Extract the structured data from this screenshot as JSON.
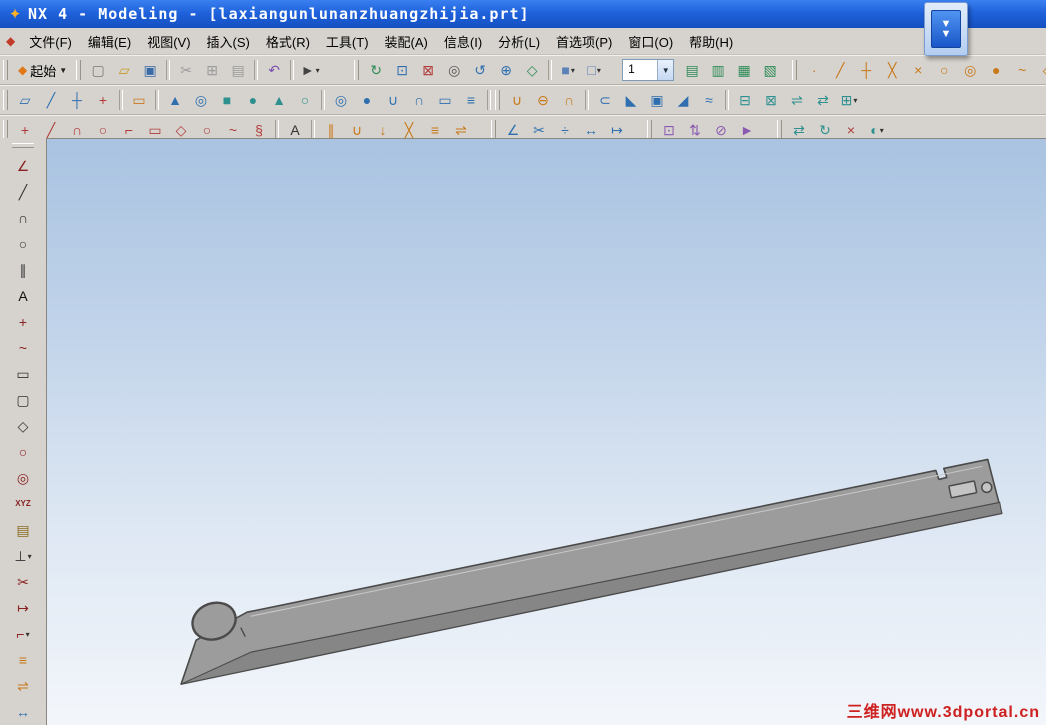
{
  "window": {
    "title": "NX 4 - Modeling - [laxiangunlunanzhuangzhijia.prt]",
    "logo_glyph": "✦"
  },
  "dock_button": {
    "chevron_glyph": "▼"
  },
  "menu_bar": {
    "app_icon_glyph": "◆",
    "items": [
      {
        "name": "menu-file",
        "label": "文件(F)"
      },
      {
        "name": "menu-edit",
        "label": "编辑(E)"
      },
      {
        "name": "menu-view",
        "label": "视图(V)"
      },
      {
        "name": "menu-insert",
        "label": "插入(S)"
      },
      {
        "name": "menu-format",
        "label": "格式(R)"
      },
      {
        "name": "menu-tools",
        "label": "工具(T)"
      },
      {
        "name": "menu-assemblies",
        "label": "装配(A)"
      },
      {
        "name": "menu-information",
        "label": "信息(I)"
      },
      {
        "name": "menu-analysis",
        "label": "分析(L)"
      },
      {
        "name": "menu-preferences",
        "label": "首选项(P)"
      },
      {
        "name": "menu-window",
        "label": "窗口(O)"
      },
      {
        "name": "menu-help",
        "label": "帮助(H)"
      }
    ]
  },
  "toolbars": {
    "standard": {
      "start_label": "起始",
      "start_icon_glyph": "◆",
      "row1a": [
        {
          "grip": true
        },
        {
          "name": "new-file-icon",
          "glyph": "▢",
          "color": "#787878"
        },
        {
          "name": "open-icon",
          "glyph": "▱",
          "color": "#c89a20"
        },
        {
          "name": "save-icon",
          "glyph": "▣",
          "color": "#3a6aa8"
        },
        {
          "sep": true
        },
        {
          "name": "cut-icon",
          "glyph": "✂",
          "color": "#9a9a9a"
        },
        {
          "name": "copy-icon",
          "glyph": "⊞",
          "color": "#9a9a9a"
        },
        {
          "name": "paste-icon",
          "glyph": "▤",
          "color": "#9a9a9a"
        },
        {
          "sep": true
        },
        {
          "name": "undo-icon",
          "glyph": "↶",
          "color": "#7a50b0"
        },
        {
          "sep": true
        },
        {
          "name": "selection-filter-icon",
          "glyph": "►",
          "color": "#444444",
          "dropdown": true
        },
        {
          "sp": 30
        }
      ],
      "row1b": [
        {
          "grip": true
        },
        {
          "name": "refresh-view-icon",
          "glyph": "↻",
          "color": "#2e8b57"
        },
        {
          "name": "fit-view-icon",
          "glyph": "⊡",
          "color": "#2f6fb0"
        },
        {
          "name": "zoom-box-icon",
          "glyph": "⊠",
          "color": "#b03a3a"
        },
        {
          "name": "zoom-in-out-icon",
          "glyph": "◎",
          "color": "#555555"
        },
        {
          "name": "rotate-view-icon",
          "glyph": "↺",
          "color": "#2f6fb0"
        },
        {
          "name": "pan-view-icon",
          "glyph": "⊕",
          "color": "#2f6fb0"
        },
        {
          "name": "perspective-icon",
          "glyph": "◇",
          "color": "#2e8b57"
        },
        {
          "sep": true
        },
        {
          "name": "shaded-view-icon",
          "glyph": "■",
          "color": "#5b82b8",
          "dropdown": true
        },
        {
          "name": "wireframe-view-icon",
          "glyph": "□",
          "color": "#5b82b8",
          "dropdown": true
        },
        {
          "sp": 10
        }
      ],
      "row1c": [
        {
          "name": "layer-settings-icon",
          "glyph": "▤",
          "color": "#2e8b57"
        },
        {
          "name": "visible-layers-icon",
          "glyph": "▥",
          "color": "#2e8b57"
        },
        {
          "name": "layer-category-icon",
          "glyph": "▦",
          "color": "#2e8b57"
        },
        {
          "name": "work-layer-icon",
          "glyph": "▧",
          "color": "#2e8b57"
        },
        {
          "sp": 8
        }
      ],
      "row1d": [
        {
          "grip": true
        },
        {
          "name": "snap-point-icon",
          "glyph": "·",
          "color": "#c87818"
        },
        {
          "name": "snap-endpoint-icon",
          "glyph": "╱",
          "color": "#c87818"
        },
        {
          "name": "snap-midpoint-icon",
          "glyph": "┼",
          "color": "#c87818"
        },
        {
          "name": "snap-control-point-icon",
          "glyph": "╳",
          "color": "#c87818"
        },
        {
          "name": "snap-intersection-icon",
          "glyph": "×",
          "color": "#c87818"
        },
        {
          "name": "snap-arc-center-icon",
          "glyph": "○",
          "color": "#c87818"
        },
        {
          "name": "snap-quadrant-icon",
          "glyph": "◎",
          "color": "#c87818"
        },
        {
          "name": "snap-existing-point-icon",
          "glyph": "●",
          "color": "#c87818"
        },
        {
          "name": "snap-point-on-curve-icon",
          "glyph": "~",
          "color": "#c87818"
        },
        {
          "name": "snap-point-on-surface-icon",
          "glyph": "◇",
          "color": "#c87818"
        }
      ]
    },
    "layer_combo": {
      "value": "1"
    },
    "row2": [
      {
        "grip": true
      },
      {
        "name": "datum-plane-icon",
        "glyph": "▱",
        "color": "#2f6fb0"
      },
      {
        "name": "datum-axis-icon",
        "glyph": "╱",
        "color": "#2f6fb0"
      },
      {
        "name": "datum-csys-icon",
        "glyph": "┼",
        "color": "#2f6fb0"
      },
      {
        "name": "point-tool-icon",
        "glyph": "+",
        "color": "#b03a3a"
      },
      {
        "sep": true
      },
      {
        "name": "sketch-icon",
        "glyph": "▭",
        "color": "#c87818"
      },
      {
        "sep": true
      },
      {
        "name": "extrude-icon",
        "glyph": "▲",
        "color": "#2f6fb0"
      },
      {
        "name": "revolve-icon",
        "glyph": "◎",
        "color": "#2f6fb0"
      },
      {
        "name": "block-icon",
        "glyph": "■",
        "color": "#2f9090"
      },
      {
        "name": "cylinder-icon",
        "glyph": "●",
        "color": "#2f9090"
      },
      {
        "name": "cone-icon",
        "glyph": "▲",
        "color": "#2f9090"
      },
      {
        "name": "sphere-icon",
        "glyph": "○",
        "color": "#2f9090"
      },
      {
        "sep": true
      },
      {
        "name": "hole-icon",
        "glyph": "◎",
        "color": "#2f6fb0"
      },
      {
        "name": "boss-icon",
        "glyph": "●",
        "color": "#2f6fb0"
      },
      {
        "name": "pocket-icon",
        "glyph": "∪",
        "color": "#2f6fb0"
      },
      {
        "name": "pad-icon",
        "glyph": "∩",
        "color": "#2f6fb0"
      },
      {
        "name": "slot-icon",
        "glyph": "▭",
        "color": "#2f6fb0"
      },
      {
        "name": "groove-icon",
        "glyph": "≡",
        "color": "#2f6fb0"
      },
      {
        "sep": true
      },
      {
        "grip": true
      },
      {
        "name": "unite-icon",
        "glyph": "∪",
        "color": "#c87818"
      },
      {
        "name": "subtract-icon",
        "glyph": "⊖",
        "color": "#c87818"
      },
      {
        "name": "intersect-icon",
        "glyph": "∩",
        "color": "#c87818"
      },
      {
        "sep": true
      },
      {
        "name": "edge-blend-icon",
        "glyph": "⊂",
        "color": "#2f6fb0"
      },
      {
        "name": "chamfer-icon",
        "glyph": "◣",
        "color": "#2f6fb0"
      },
      {
        "name": "shell-icon",
        "glyph": "▣",
        "color": "#2f6fb0"
      },
      {
        "name": "taper-icon",
        "glyph": "◢",
        "color": "#2f6fb0"
      },
      {
        "name": "thread-icon",
        "glyph": "≈",
        "color": "#2f6fb0"
      },
      {
        "sep": true
      },
      {
        "name": "trim-body-icon",
        "glyph": "⊟",
        "color": "#2f9090"
      },
      {
        "name": "split-body-icon",
        "glyph": "⊠",
        "color": "#2f9090"
      },
      {
        "name": "sew-icon",
        "glyph": "⇌",
        "color": "#2f9090"
      },
      {
        "name": "mirror-body-icon",
        "glyph": "⇄",
        "color": "#2f9090"
      },
      {
        "name": "instance-feature-icon",
        "glyph": "⊞",
        "color": "#2f9090",
        "dropdown": true
      }
    ],
    "row3": [
      {
        "grip": true
      },
      {
        "name": "curve-point-icon",
        "glyph": "+",
        "color": "#b03a3a"
      },
      {
        "name": "line-icon",
        "glyph": "╱",
        "color": "#b03a3a"
      },
      {
        "name": "arc-icon",
        "glyph": "∩",
        "color": "#b03a3a"
      },
      {
        "name": "circle-icon",
        "glyph": "○",
        "color": "#b03a3a"
      },
      {
        "name": "fillet-curve-icon",
        "glyph": "⌐",
        "color": "#b03a3a"
      },
      {
        "name": "rectangle-icon",
        "glyph": "▭",
        "color": "#b03a3a"
      },
      {
        "name": "polygon-icon",
        "glyph": "◇",
        "color": "#b03a3a"
      },
      {
        "name": "ellipse-icon",
        "glyph": "○",
        "color": "#b03a3a"
      },
      {
        "name": "spline-icon",
        "glyph": "~",
        "color": "#b03a3a"
      },
      {
        "name": "helix-icon",
        "glyph": "§",
        "color": "#b03a3a"
      },
      {
        "sep": true
      },
      {
        "name": "text-curve-icon",
        "glyph": "A",
        "color": "#333333"
      },
      {
        "sep": true
      },
      {
        "name": "offset-curve-icon",
        "glyph": "∥",
        "color": "#c87818"
      },
      {
        "name": "bridge-curve-icon",
        "glyph": "∪",
        "color": "#c87818"
      },
      {
        "name": "project-curve-icon",
        "glyph": "↓",
        "color": "#c87818"
      },
      {
        "name": "intersection-curve-icon",
        "glyph": "╳",
        "color": "#c87818"
      },
      {
        "name": "section-curve-icon",
        "glyph": "≡",
        "color": "#c87818"
      },
      {
        "name": "join-curve-icon",
        "glyph": "⇌",
        "color": "#c87818"
      },
      {
        "sp": 16
      },
      {
        "grip": true
      },
      {
        "name": "edit-curve-parameters-icon",
        "glyph": "∠",
        "color": "#2f6fb0"
      },
      {
        "name": "trim-curve-icon",
        "glyph": "✂",
        "color": "#2f6fb0"
      },
      {
        "name": "divide-curve-icon",
        "glyph": "÷",
        "color": "#2f6fb0"
      },
      {
        "name": "stretch-curve-icon",
        "glyph": "↔",
        "color": "#2f6fb0"
      },
      {
        "name": "curve-length-icon",
        "glyph": "↦",
        "color": "#2f6fb0"
      },
      {
        "sp": 16
      },
      {
        "grip": true
      },
      {
        "name": "edit-feature-icon",
        "glyph": "⊡",
        "color": "#8a5ab0"
      },
      {
        "name": "reorder-feature-icon",
        "glyph": "⇅",
        "color": "#8a5ab0"
      },
      {
        "name": "suppress-feature-icon",
        "glyph": "⊘",
        "color": "#8a5ab0"
      },
      {
        "name": "playback-icon",
        "glyph": "►",
        "color": "#8a5ab0"
      },
      {
        "sp": 16
      },
      {
        "grip": true
      },
      {
        "name": "move-object-icon",
        "glyph": "⇄",
        "color": "#2f9090"
      },
      {
        "name": "transform-icon",
        "glyph": "↻",
        "color": "#2f9090"
      },
      {
        "name": "delete-icon",
        "glyph": "×",
        "color": "#b03a3a"
      },
      {
        "name": "show-hide-icon",
        "glyph": "◐",
        "color": "#2f9090",
        "dropdown": true
      }
    ],
    "left": [
      {
        "name": "profile-icon",
        "glyph": "∠",
        "color": "#8a2020"
      },
      {
        "name": "line-sketch-icon",
        "glyph": "╱",
        "color": "#333333"
      },
      {
        "name": "arc-sketch-icon",
        "glyph": "∩",
        "color": "#333333"
      },
      {
        "name": "circle-sketch-icon",
        "glyph": "○",
        "color": "#333333"
      },
      {
        "name": "derived-line-icon",
        "glyph": "∥",
        "color": "#333333"
      },
      {
        "name": "text-tool-icon",
        "glyph": "A",
        "color": "#111111"
      },
      {
        "name": "point-sketch-icon",
        "glyph": "+",
        "color": "#8a2020"
      },
      {
        "name": "spline-sketch-icon",
        "glyph": "~",
        "color": "#8a2020"
      },
      {
        "name": "rectangle-sketch-icon",
        "glyph": "▭",
        "color": "#333333"
      },
      {
        "name": "rounded-rectangle-icon",
        "glyph": "▢",
        "color": "#333333"
      },
      {
        "name": "polygon-sketch-icon",
        "glyph": "◇",
        "color": "#333333"
      },
      {
        "name": "ellipse-sketch-icon",
        "glyph": "○",
        "color": "#8a2020"
      },
      {
        "name": "ring-icon",
        "glyph": "◎",
        "color": "#8a2020"
      },
      {
        "name": "xyz-point-icon",
        "glyph": "XYZ",
        "color": "#8a2020",
        "small": true
      },
      {
        "name": "clipboard-tool-icon",
        "glyph": "▤",
        "color": "#8a6a20"
      },
      {
        "name": "constraint-icon",
        "glyph": "⊥",
        "color": "#333333",
        "dropdown": true
      },
      {
        "name": "trim-tool-icon",
        "glyph": "✂",
        "color": "#8a2020"
      },
      {
        "name": "extend-tool-icon",
        "glyph": "↦",
        "color": "#8a2020"
      },
      {
        "name": "fillet-tool-icon",
        "glyph": "⌐",
        "color": "#8a2020",
        "dropdown": true
      },
      {
        "name": "offset-tool-icon",
        "glyph": "≡",
        "color": "#c87818"
      },
      {
        "name": "mirror-tool-icon",
        "glyph": "⇌",
        "color": "#c87818"
      },
      {
        "name": "dimension-icon",
        "glyph": "↔",
        "color": "#2f6fb0"
      }
    ]
  },
  "viewport": {
    "watermark": "三维网www.3dportal.cn",
    "background_top": "#a9c3e1",
    "background_bottom": "#f3f6fb"
  },
  "part": {
    "face_color": "#9c9c9c",
    "flange_color": "#868686",
    "hole_fill": "#c4c4c4",
    "edge_color": "#4a4a4a"
  }
}
